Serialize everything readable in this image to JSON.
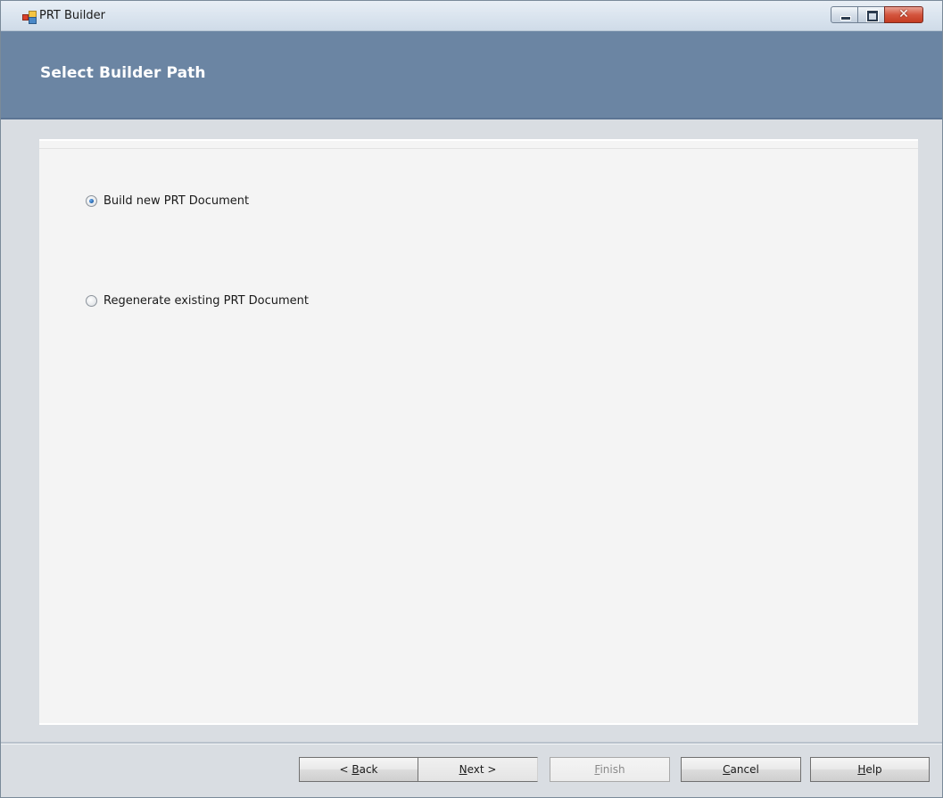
{
  "window": {
    "title": "PRT Builder",
    "close_glyph": "✕"
  },
  "header": {
    "title": "Select Builder Path"
  },
  "options": [
    {
      "label": "Build new PRT Document",
      "selected": true
    },
    {
      "label": "Regenerate existing PRT Document",
      "selected": false
    }
  ],
  "buttons": {
    "back": {
      "prefix": "< ",
      "mnemonic": "B",
      "rest": "ack",
      "enabled": true
    },
    "next": {
      "prefix": "",
      "mnemonic": "N",
      "rest": "ext >",
      "enabled": true
    },
    "finish": {
      "prefix": "",
      "mnemonic": "F",
      "rest": "inish",
      "enabled": false
    },
    "cancel": {
      "prefix": "",
      "mnemonic": "C",
      "rest": "ancel",
      "enabled": true
    },
    "help": {
      "prefix": "",
      "mnemonic": "H",
      "rest": "elp",
      "enabled": true
    }
  },
  "colors": {
    "header_band": "#6b85a3",
    "radio_checked": "#1f5fa8",
    "close_button": "#c43b22"
  }
}
